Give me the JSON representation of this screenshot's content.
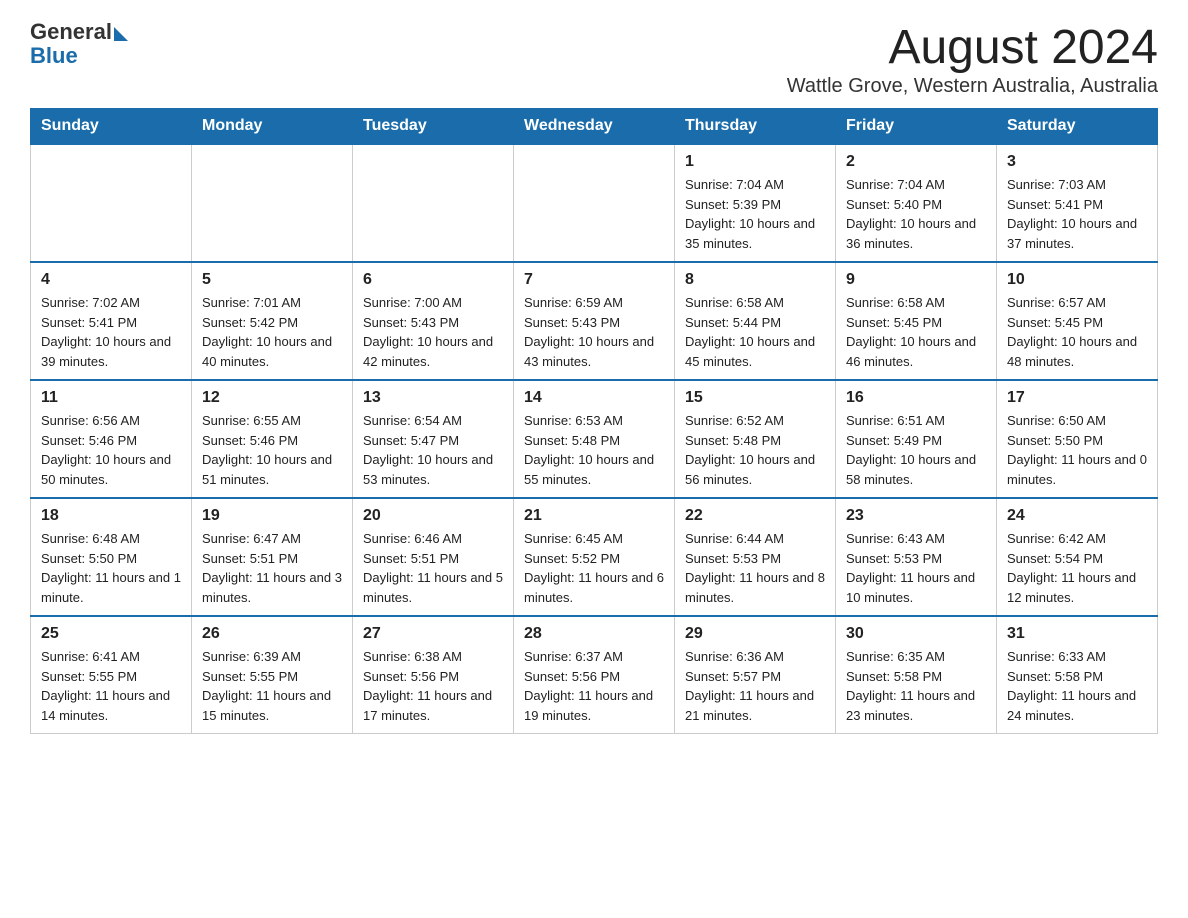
{
  "logo": {
    "general": "General",
    "blue": "Blue"
  },
  "title": "August 2024",
  "subtitle": "Wattle Grove, Western Australia, Australia",
  "days_of_week": [
    "Sunday",
    "Monday",
    "Tuesday",
    "Wednesday",
    "Thursday",
    "Friday",
    "Saturday"
  ],
  "weeks": [
    [
      {
        "day": "",
        "info": ""
      },
      {
        "day": "",
        "info": ""
      },
      {
        "day": "",
        "info": ""
      },
      {
        "day": "",
        "info": ""
      },
      {
        "day": "1",
        "info": "Sunrise: 7:04 AM\nSunset: 5:39 PM\nDaylight: 10 hours and 35 minutes."
      },
      {
        "day": "2",
        "info": "Sunrise: 7:04 AM\nSunset: 5:40 PM\nDaylight: 10 hours and 36 minutes."
      },
      {
        "day": "3",
        "info": "Sunrise: 7:03 AM\nSunset: 5:41 PM\nDaylight: 10 hours and 37 minutes."
      }
    ],
    [
      {
        "day": "4",
        "info": "Sunrise: 7:02 AM\nSunset: 5:41 PM\nDaylight: 10 hours and 39 minutes."
      },
      {
        "day": "5",
        "info": "Sunrise: 7:01 AM\nSunset: 5:42 PM\nDaylight: 10 hours and 40 minutes."
      },
      {
        "day": "6",
        "info": "Sunrise: 7:00 AM\nSunset: 5:43 PM\nDaylight: 10 hours and 42 minutes."
      },
      {
        "day": "7",
        "info": "Sunrise: 6:59 AM\nSunset: 5:43 PM\nDaylight: 10 hours and 43 minutes."
      },
      {
        "day": "8",
        "info": "Sunrise: 6:58 AM\nSunset: 5:44 PM\nDaylight: 10 hours and 45 minutes."
      },
      {
        "day": "9",
        "info": "Sunrise: 6:58 AM\nSunset: 5:45 PM\nDaylight: 10 hours and 46 minutes."
      },
      {
        "day": "10",
        "info": "Sunrise: 6:57 AM\nSunset: 5:45 PM\nDaylight: 10 hours and 48 minutes."
      }
    ],
    [
      {
        "day": "11",
        "info": "Sunrise: 6:56 AM\nSunset: 5:46 PM\nDaylight: 10 hours and 50 minutes."
      },
      {
        "day": "12",
        "info": "Sunrise: 6:55 AM\nSunset: 5:46 PM\nDaylight: 10 hours and 51 minutes."
      },
      {
        "day": "13",
        "info": "Sunrise: 6:54 AM\nSunset: 5:47 PM\nDaylight: 10 hours and 53 minutes."
      },
      {
        "day": "14",
        "info": "Sunrise: 6:53 AM\nSunset: 5:48 PM\nDaylight: 10 hours and 55 minutes."
      },
      {
        "day": "15",
        "info": "Sunrise: 6:52 AM\nSunset: 5:48 PM\nDaylight: 10 hours and 56 minutes."
      },
      {
        "day": "16",
        "info": "Sunrise: 6:51 AM\nSunset: 5:49 PM\nDaylight: 10 hours and 58 minutes."
      },
      {
        "day": "17",
        "info": "Sunrise: 6:50 AM\nSunset: 5:50 PM\nDaylight: 11 hours and 0 minutes."
      }
    ],
    [
      {
        "day": "18",
        "info": "Sunrise: 6:48 AM\nSunset: 5:50 PM\nDaylight: 11 hours and 1 minute."
      },
      {
        "day": "19",
        "info": "Sunrise: 6:47 AM\nSunset: 5:51 PM\nDaylight: 11 hours and 3 minutes."
      },
      {
        "day": "20",
        "info": "Sunrise: 6:46 AM\nSunset: 5:51 PM\nDaylight: 11 hours and 5 minutes."
      },
      {
        "day": "21",
        "info": "Sunrise: 6:45 AM\nSunset: 5:52 PM\nDaylight: 11 hours and 6 minutes."
      },
      {
        "day": "22",
        "info": "Sunrise: 6:44 AM\nSunset: 5:53 PM\nDaylight: 11 hours and 8 minutes."
      },
      {
        "day": "23",
        "info": "Sunrise: 6:43 AM\nSunset: 5:53 PM\nDaylight: 11 hours and 10 minutes."
      },
      {
        "day": "24",
        "info": "Sunrise: 6:42 AM\nSunset: 5:54 PM\nDaylight: 11 hours and 12 minutes."
      }
    ],
    [
      {
        "day": "25",
        "info": "Sunrise: 6:41 AM\nSunset: 5:55 PM\nDaylight: 11 hours and 14 minutes."
      },
      {
        "day": "26",
        "info": "Sunrise: 6:39 AM\nSunset: 5:55 PM\nDaylight: 11 hours and 15 minutes."
      },
      {
        "day": "27",
        "info": "Sunrise: 6:38 AM\nSunset: 5:56 PM\nDaylight: 11 hours and 17 minutes."
      },
      {
        "day": "28",
        "info": "Sunrise: 6:37 AM\nSunset: 5:56 PM\nDaylight: 11 hours and 19 minutes."
      },
      {
        "day": "29",
        "info": "Sunrise: 6:36 AM\nSunset: 5:57 PM\nDaylight: 11 hours and 21 minutes."
      },
      {
        "day": "30",
        "info": "Sunrise: 6:35 AM\nSunset: 5:58 PM\nDaylight: 11 hours and 23 minutes."
      },
      {
        "day": "31",
        "info": "Sunrise: 6:33 AM\nSunset: 5:58 PM\nDaylight: 11 hours and 24 minutes."
      }
    ]
  ]
}
